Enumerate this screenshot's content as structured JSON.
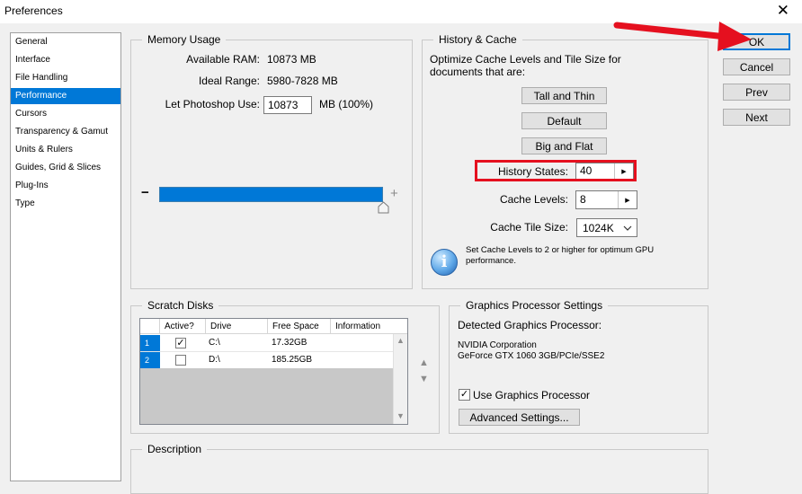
{
  "window": {
    "title": "Preferences",
    "close_glyph": "✕"
  },
  "nav": {
    "items": [
      {
        "label": "General"
      },
      {
        "label": "Interface"
      },
      {
        "label": "File Handling"
      },
      {
        "label": "Performance",
        "selected": true
      },
      {
        "label": "Cursors"
      },
      {
        "label": "Transparency & Gamut"
      },
      {
        "label": "Units & Rulers"
      },
      {
        "label": "Guides, Grid & Slices"
      },
      {
        "label": "Plug-Ins"
      },
      {
        "label": "Type"
      }
    ]
  },
  "memory": {
    "legend": "Memory Usage",
    "available_label": "Available RAM:",
    "available_value": "10873 MB",
    "ideal_label": "Ideal Range:",
    "ideal_value": "5980-7828 MB",
    "let_label": "Let Photoshop Use:",
    "let_value": "10873",
    "let_suffix": "MB (100%)",
    "minus": "−",
    "plus": "+",
    "slider_percent": 100
  },
  "history_cache": {
    "legend": "History & Cache",
    "intro": "Optimize Cache Levels and Tile Size for documents that are:",
    "btn_tall_thin": "Tall and Thin",
    "btn_default": "Default",
    "btn_big_flat": "Big and Flat",
    "history_states_label": "History States:",
    "history_states_value": "40",
    "cache_levels_label": "Cache Levels:",
    "cache_levels_value": "8",
    "cache_tile_label": "Cache Tile Size:",
    "cache_tile_value": "1024K",
    "info_text": "Set Cache Levels to 2 or higher for optimum GPU performance.",
    "info_glyph": "i"
  },
  "scratch": {
    "legend": "Scratch Disks",
    "columns": [
      "Active?",
      "Drive",
      "Free Space",
      "Information"
    ],
    "rows": [
      {
        "num": "1",
        "checked": true,
        "drive": "C:\\",
        "free": "17.32GB",
        "info": ""
      },
      {
        "num": "2",
        "checked": false,
        "drive": "D:\\",
        "free": "185.25GB",
        "info": ""
      }
    ]
  },
  "gpu": {
    "legend": "Graphics Processor Settings",
    "detected_label": "Detected Graphics Processor:",
    "vendor": "NVIDIA Corporation",
    "model": "GeForce GTX 1060 3GB/PCIe/SSE2",
    "use_gpu_label": "Use Graphics Processor",
    "use_gpu_checked": true,
    "advanced_btn": "Advanced Settings..."
  },
  "description": {
    "legend": "Description"
  },
  "actions": {
    "ok": "OK",
    "cancel": "Cancel",
    "prev": "Prev",
    "next": "Next"
  },
  "annotation": {
    "highlight_color": "#e5101f",
    "arrow_color": "#e5101f"
  },
  "colors": {
    "accent": "#0078d7"
  }
}
